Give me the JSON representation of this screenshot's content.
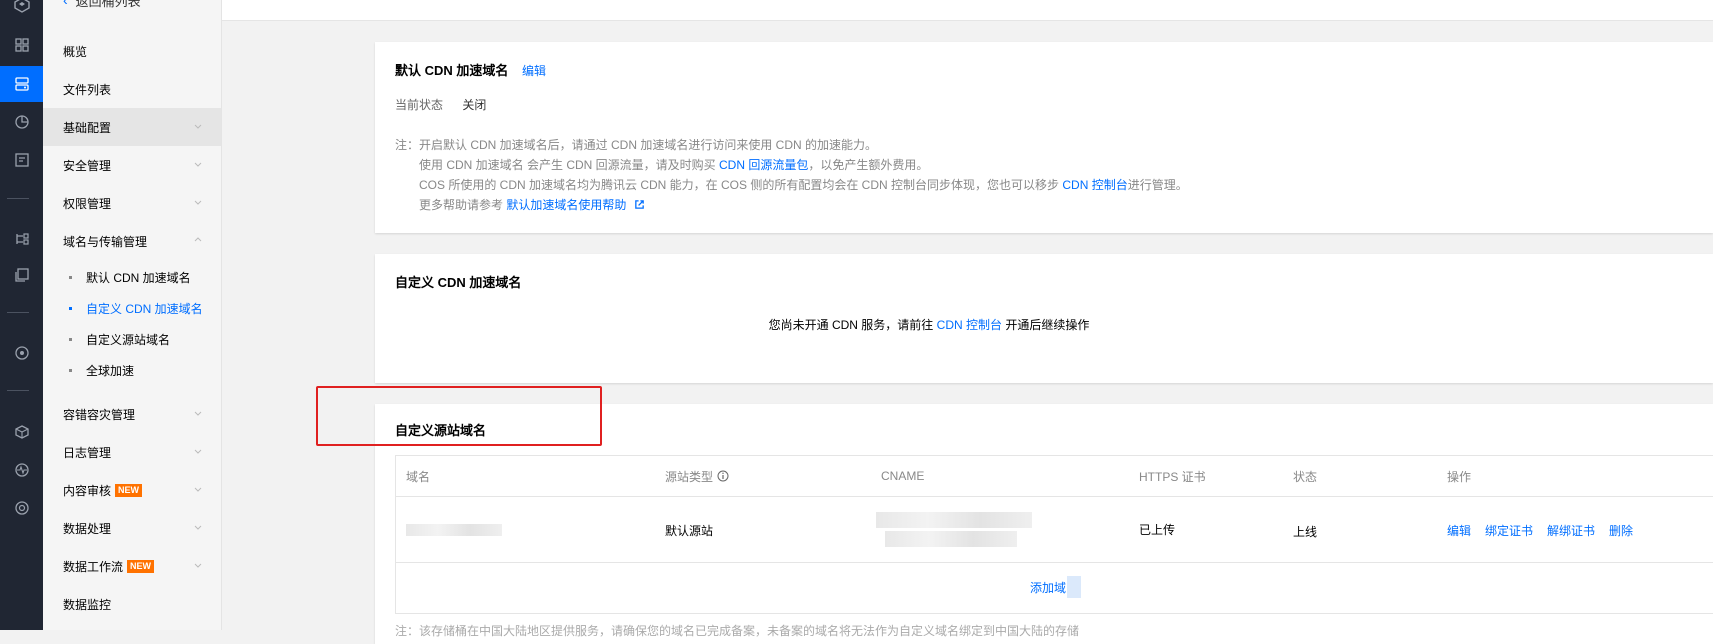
{
  "sidebar": {
    "back_label": "返回桶列表",
    "items": [
      {
        "label": "概览"
      },
      {
        "label": "文件列表"
      },
      {
        "label": "基础配置"
      },
      {
        "label": "安全管理"
      },
      {
        "label": "权限管理"
      },
      {
        "label": "域名与传输管理"
      }
    ],
    "sub_items": [
      {
        "label": "默认 CDN 加速域名"
      },
      {
        "label": "自定义 CDN 加速域名"
      },
      {
        "label": "自定义源站域名"
      },
      {
        "label": "全球加速"
      }
    ],
    "items_after": [
      {
        "label": "容错容灾管理"
      },
      {
        "label": "日志管理"
      },
      {
        "label": "内容审核",
        "badge": "NEW"
      },
      {
        "label": "数据处理"
      },
      {
        "label": "数据工作流",
        "badge": "NEW"
      },
      {
        "label": "数据监控"
      }
    ]
  },
  "default_cdn": {
    "title": "默认 CDN 加速域名",
    "edit_label": "编辑",
    "status_label": "当前状态",
    "status_value": "关闭",
    "note_prefix": "注：",
    "note1": "开启默认 CDN 加速域名后，请通过 CDN 加速域名进行访问来使用 CDN 的加速能力。",
    "note2_a": "使用 CDN 加速域名 会产生 CDN 回源流量，请及时购买 ",
    "note2_link": "CDN 回源流量包",
    "note2_b": "，以免产生额外费用。",
    "note3_a": "COS 所使用的 CDN 加速域名均为腾讯云 CDN 能力，在 COS 侧的所有配置均会在 CDN 控制台同步体现，您也可以移步 ",
    "note3_link": "CDN 控制台",
    "note3_b": "进行管理。",
    "note4_a": "更多帮助请参考 ",
    "note4_link": "默认加速域名使用帮助"
  },
  "custom_cdn": {
    "title": "自定义 CDN 加速域名",
    "msg_a": "您尚未开通 CDN 服务，请前往 ",
    "msg_link": "CDN 控制台",
    "msg_b": " 开通后继续操作"
  },
  "origin_domain": {
    "title": "自定义源站域名",
    "columns": {
      "domain": "域名",
      "origin_type": "源站类型",
      "cname": "CNAME",
      "https": "HTTPS 证书",
      "status": "状态",
      "ops": "操作"
    },
    "row": {
      "origin_type": "默认源站",
      "https": "已上传",
      "status": "上线",
      "op_edit": "编辑",
      "op_bind": "绑定证书",
      "op_unbind": "解绑证书",
      "op_delete": "删除"
    },
    "add_label": "添加域",
    "bottom_note": "注：该存储桶在中国大陆地区提供服务，请确保您的域名已完成备案，未备案的域名将无法作为自定义域名绑定到中国大陆的存储"
  }
}
